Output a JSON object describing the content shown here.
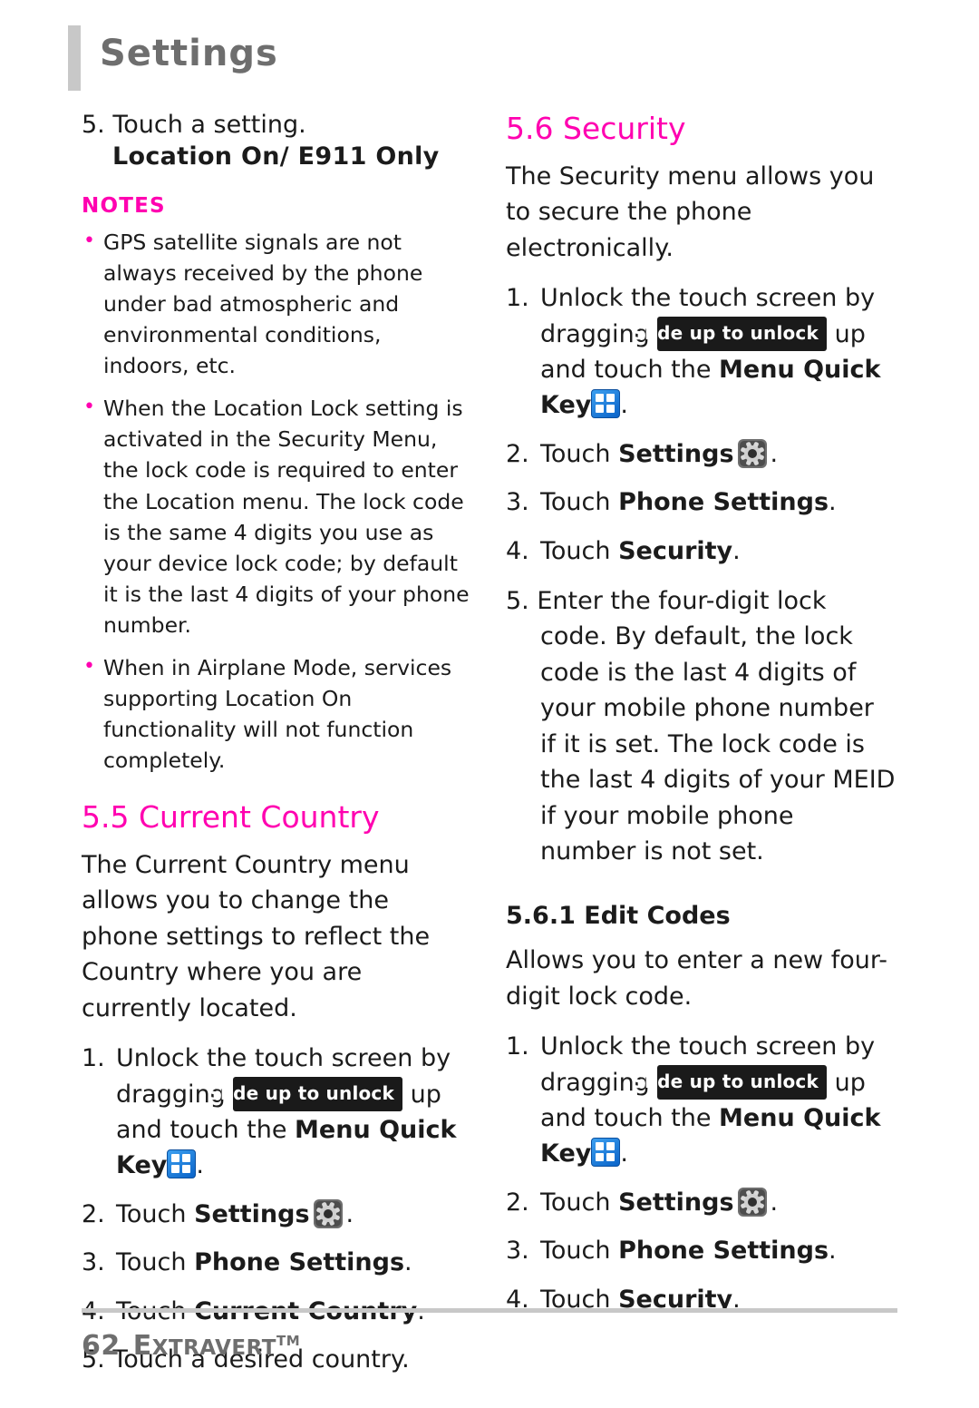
{
  "header": {
    "title": "Settings"
  },
  "left": {
    "step5_setting": "5. Touch a setting.",
    "subhead": "Location On/ E911 Only",
    "notes_title": "NOTES",
    "notes": [
      "GPS satellite signals are not always received by the phone under bad atmospheric and environmental conditions, indoors, etc.",
      "When the Location Lock setting is activated in the Security Menu, the lock code is required to enter the Location menu. The lock code is the same 4 digits you use as your device lock code; by default it is the last 4 digits of your phone number.",
      "When in Airplane Mode, services supporting Location On functionality will not function completely."
    ],
    "section_title": "5.5 Current Country",
    "intro": "The Current Country menu allows you to change the phone settings to reflect the Country where you are currently located.",
    "steps": {
      "s1_a": "1.",
      "s1_b": "Unlock the touch screen by dragging",
      "s1_badge": "Slide up to unlock",
      "s1_c": "up and touch the",
      "s1_d": "Menu Quick Key",
      "s1_e": ".",
      "s2_a": "2.",
      "s2_b": "Touch",
      "s2_c": "Settings",
      "s2_d": ".",
      "s3_a": "3.",
      "s3_b": "Touch",
      "s3_c": "Phone Settings",
      "s3_d": ".",
      "s4_a": "4.",
      "s4_b": "Touch",
      "s4_c": "Current Country",
      "s4_d": ".",
      "s5": "5. Touch a desired country."
    }
  },
  "right": {
    "section_title": "5.6 Security",
    "intro": "The Security menu allows you to secure the phone electronically.",
    "steps": {
      "s1_a": "1.",
      "s1_b": "Unlock the touch screen by dragging",
      "s1_badge": "Slide up to unlock",
      "s1_c": "up and touch the",
      "s1_d": "Menu Quick Key",
      "s1_e": ".",
      "s2_a": "2.",
      "s2_b": "Touch",
      "s2_c": "Settings",
      "s2_d": ".",
      "s3_a": "3.",
      "s3_b": "Touch",
      "s3_c": "Phone Settings",
      "s3_d": ".",
      "s4_a": "4.",
      "s4_b": "Touch",
      "s4_c": "Security",
      "s4_d": ".",
      "s5": "5. Enter the four-digit lock code. By default, the lock code is the last 4 digits of your mobile phone number if it is set. The lock code is the last 4 digits of your MEID if your mobile phone number is not set."
    },
    "subsection_title": "5.6.1 Edit Codes",
    "subsection_intro": "Allows you to enter a new four-digit lock code.",
    "steps2": {
      "s1_a": "1.",
      "s1_b": "Unlock the touch screen by dragging",
      "s1_badge": "Slide up to unlock",
      "s1_c": "up and touch the",
      "s1_d": "Menu Quick Key",
      "s1_e": ".",
      "s2_a": "2.",
      "s2_b": "Touch",
      "s2_c": "Settings",
      "s2_d": ".",
      "s3_a": "3.",
      "s3_b": "Touch",
      "s3_c": "Phone Settings",
      "s3_d": ".",
      "s4_a": "4.",
      "s4_b": "Touch",
      "s4_c": "Security",
      "s4_d": "."
    }
  },
  "footer": {
    "page_number": "62",
    "model": "Extravert",
    "trademark": "TM"
  },
  "colors": {
    "accent": "#ff00b0",
    "header_gray": "#6e6e6e",
    "rule_gray": "#c8c8c8",
    "badge_black": "#1a1a1a",
    "quickkey_blue": "#0a63c8"
  }
}
